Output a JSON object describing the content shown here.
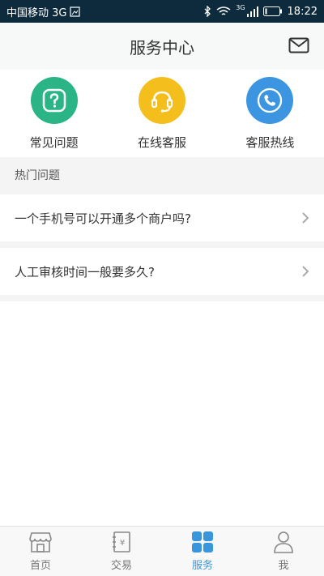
{
  "status_bar": {
    "carrier": "中国移动 3G",
    "network_badge": "3G",
    "time": "18:22"
  },
  "header": {
    "title": "服务中心",
    "mail_icon": "mail-icon"
  },
  "quick_actions": [
    {
      "label": "常见问题",
      "icon": "question-icon",
      "color": "#2bb486"
    },
    {
      "label": "在线客服",
      "icon": "headset-icon",
      "color": "#f4be1c"
    },
    {
      "label": "客服热线",
      "icon": "phone-icon",
      "color": "#3b95e0"
    }
  ],
  "hot_questions": {
    "title": "热门问题",
    "items": [
      "一个手机号可以开通多个商户吗?",
      "人工审核时间一般要多久?"
    ]
  },
  "tabbar": {
    "active_color": "#3a96db",
    "items": [
      {
        "label": "首页",
        "icon": "home-store-icon"
      },
      {
        "label": "交易",
        "icon": "transaction-icon"
      },
      {
        "label": "服务",
        "icon": "service-grid-icon"
      },
      {
        "label": "我",
        "icon": "user-icon"
      }
    ]
  }
}
